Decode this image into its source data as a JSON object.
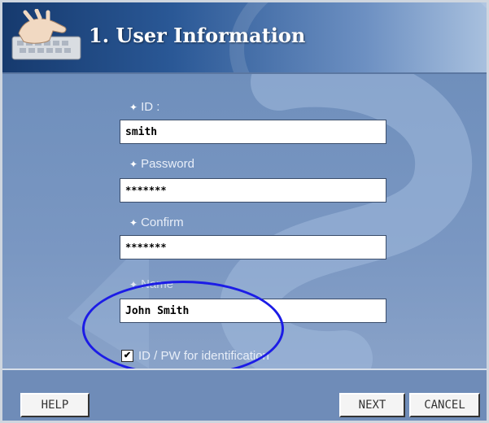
{
  "header": {
    "title": "1. User Information"
  },
  "form": {
    "id_label": "ID :",
    "id_value": "smith",
    "password_label": "Password",
    "password_value": "*******",
    "confirm_label": "Confirm",
    "confirm_value": "*******",
    "name_label": "Name",
    "name_value": "John Smith",
    "identification_label": "ID / PW for identification",
    "identification_checked": true
  },
  "footer": {
    "help_label": "HELP",
    "next_label": "NEXT",
    "cancel_label": "CANCEL"
  },
  "colors": {
    "header_dark": "#163a6e",
    "body_blue": "#7c98c0",
    "annotation": "#1c1ce6"
  },
  "icons": {
    "header_icon": "hand-on-keyboard-icon",
    "bullet": "diamond-bullet-icon",
    "check": "checkmark-icon"
  }
}
